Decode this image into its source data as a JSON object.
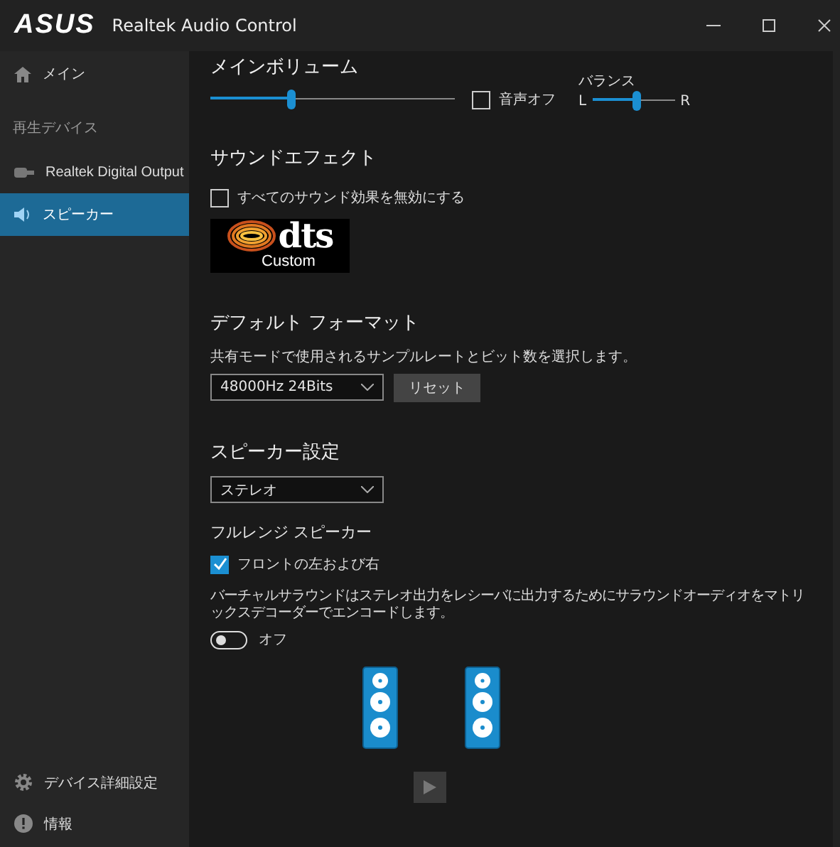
{
  "window": {
    "logo": "ASUS",
    "title": "Realtek Audio Control"
  },
  "sidebar": {
    "items": [
      {
        "kind": "home",
        "label": "メイン",
        "selected": false
      },
      {
        "kind": "header",
        "label": "再生デバイス"
      },
      {
        "kind": "device",
        "label": "Realtek Digital Output",
        "selected": false
      },
      {
        "kind": "speaker",
        "label": "スピーカー",
        "selected": true
      }
    ],
    "bottom_items": [
      {
        "kind": "gear",
        "label": "デバイス詳細設定"
      },
      {
        "kind": "info",
        "label": "情報"
      }
    ]
  },
  "main_volume": {
    "title": "メインボリューム",
    "level": 0.33,
    "mute": {
      "label": "音声オフ",
      "checked": false
    },
    "balance": {
      "label": "バランス",
      "left": "L",
      "right": "R",
      "level": 0.55
    }
  },
  "sound_effect": {
    "title": "サウンドエフェクト",
    "disable_all": {
      "label": "すべてのサウンド効果を無効にする",
      "checked": false
    },
    "logo": {
      "mark": "dts",
      "caption": "Custom"
    }
  },
  "default_format": {
    "title": "デフォルト フォーマット",
    "description": "共有モードで使用されるサンプルレートとビット数を選択します。",
    "value": "48000Hz 24Bits",
    "reset": "リセット"
  },
  "speaker_setup": {
    "title": "スピーカー設定",
    "value": "ステレオ",
    "full_range_title": "フルレンジ スピーカー",
    "front": {
      "label": "フロントの左および右",
      "checked": true
    },
    "virtual_surround": {
      "description": "バーチャルサラウンドはステレオ出力をレシーバに出力するためにサラウンドオーディオをマトリックスデコーダーでエンコードします。",
      "on": false,
      "label": "オフ"
    },
    "play_disabled": true
  }
}
